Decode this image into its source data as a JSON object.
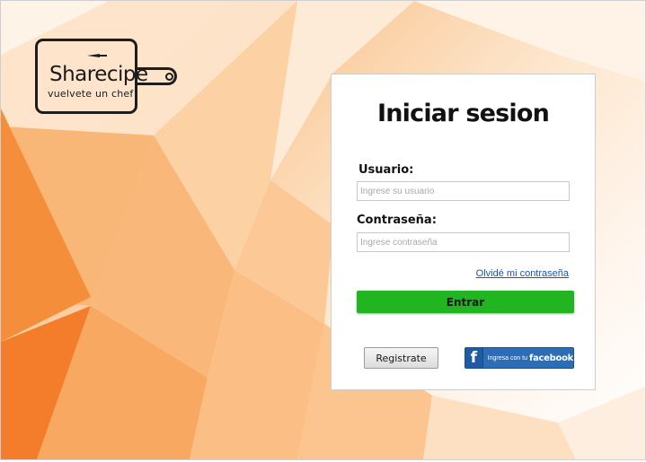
{
  "logo": {
    "name": "Sharecipe",
    "tagline": "vuelvete un chef"
  },
  "login": {
    "title": "Iniciar sesion",
    "username_label": "Usuario:",
    "username_placeholder": "Ingrese su usuario",
    "username_value": "",
    "password_label": "Contraseña:",
    "password_placeholder": "Ingrese contraseña",
    "password_value": "",
    "forgot_link": "Olvidé mi contraseña",
    "submit_button": "Entrar",
    "register_button": "Registrate",
    "facebook_button": {
      "prefix": "Ingresa con tu",
      "brand": "facebook",
      "icon_letter": "f"
    }
  },
  "colors": {
    "accent_green": "#22b522",
    "facebook_blue": "#2d6db5",
    "link_blue": "#1a55b8",
    "background_orange": "#f7a460"
  },
  "icons": {
    "logo": "cutting-board-icon",
    "knife": "knife-icon",
    "facebook": "facebook-f-icon"
  }
}
